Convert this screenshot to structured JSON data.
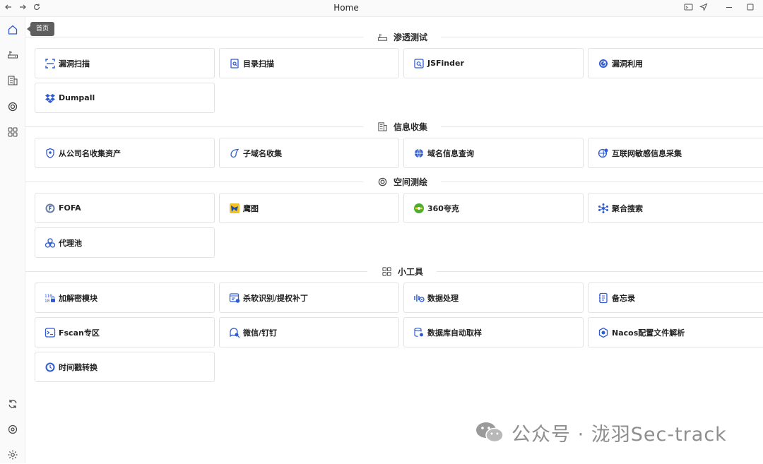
{
  "window": {
    "title": "Home",
    "nav_back_icon": "arrow-left-icon",
    "nav_forward_icon": "arrow-right-icon",
    "reload_icon": "reload-icon"
  },
  "rail": {
    "tooltip": "首页",
    "items": [
      "home-icon",
      "router-icon",
      "building-icon",
      "spiral-icon",
      "grid-icon"
    ],
    "bottom_items": [
      "sync-icon",
      "camera-settings-icon",
      "settings-icon"
    ]
  },
  "sections": [
    {
      "title": "渗透测试",
      "icon": "router-icon",
      "cards": [
        {
          "label": "漏洞扫描",
          "icon": "scan-frame-icon"
        },
        {
          "label": "目录扫描",
          "icon": "document-scan-icon"
        },
        {
          "label": "JSFinder",
          "icon": "search-window-icon"
        },
        {
          "label": "漏洞利用",
          "icon": "exploit-gauge-icon"
        },
        {
          "label": "Dumpall",
          "icon": "dropbox-icon"
        }
      ]
    },
    {
      "title": "信息收集",
      "icon": "building-icon",
      "cards": [
        {
          "label": "从公司名收集资产",
          "icon": "shield-icon"
        },
        {
          "label": "子域名收集",
          "icon": "droplet-icon"
        },
        {
          "label": "域名信息查询",
          "icon": "globe-icon"
        },
        {
          "label": "互联网敏感信息采集",
          "icon": "globe-gear-icon"
        }
      ]
    },
    {
      "title": "空间测绘",
      "icon": "spiral-icon",
      "cards": [
        {
          "label": "FOFA",
          "icon": "fofa-logo-icon"
        },
        {
          "label": "鹰图",
          "icon": "eagle-map-icon"
        },
        {
          "label": "360夸克",
          "icon": "quake-360-icon"
        },
        {
          "label": "聚合搜索",
          "icon": "network-icon"
        },
        {
          "label": "代理池",
          "icon": "biohazard-icon"
        }
      ]
    },
    {
      "title": "小工具",
      "icon": "grid-icon",
      "cards": [
        {
          "label": "加解密模块",
          "icon": "binary-lock-icon"
        },
        {
          "label": "杀软识别/提权补丁",
          "icon": "window-check-icon"
        },
        {
          "label": "数据处理",
          "icon": "data-process-icon"
        },
        {
          "label": "备忘录",
          "icon": "notebook-icon"
        },
        {
          "label": "Fscan专区",
          "icon": "terminal-window-icon"
        },
        {
          "label": "微信/钉钉",
          "icon": "chat-search-icon"
        },
        {
          "label": "数据库自动取样",
          "icon": "database-search-icon"
        },
        {
          "label": "Nacos配置文件解析",
          "icon": "gear-cube-icon"
        },
        {
          "label": "时间戳转换",
          "icon": "clock-icon"
        }
      ]
    }
  ],
  "watermark": "公众号 · 泷羽Sec-track",
  "colors": {
    "accent": "#2f5bd3",
    "border": "#e3e3e3",
    "rail_bg": "#fafafa"
  }
}
